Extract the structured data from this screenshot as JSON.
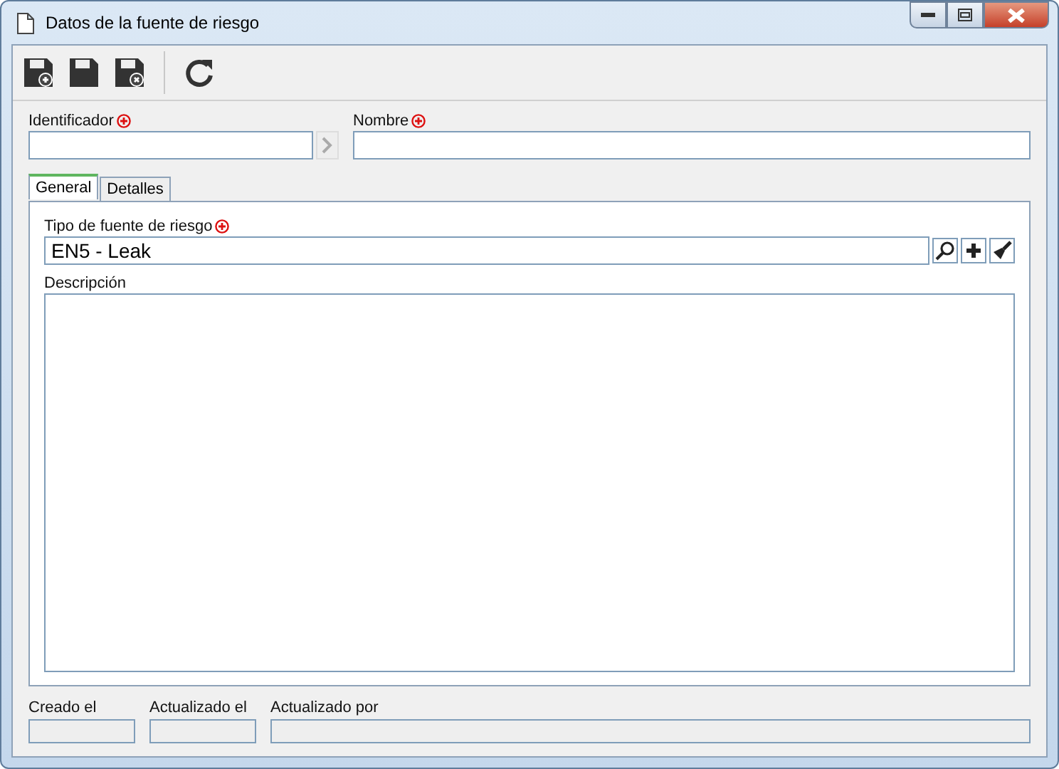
{
  "window": {
    "title": "Datos de la fuente de riesgo"
  },
  "toolbar": [
    {
      "kind": "save-new"
    },
    {
      "kind": "save"
    },
    {
      "kind": "save-close"
    },
    {
      "kind": "refresh"
    }
  ],
  "header_fields": [
    {
      "label": "Identificador",
      "required": true,
      "has_next": true
    },
    {
      "label": "Nombre",
      "required": true,
      "has_next": false
    }
  ],
  "tabs": [
    {
      "label": "General",
      "selected": true
    },
    {
      "label": "Detalles",
      "selected": false
    }
  ],
  "risk_source_type": {
    "label": "Tipo de fuente de riesgo",
    "required": true,
    "value": "EN5 - Leak"
  },
  "description": {
    "label": "Descripción"
  },
  "footer_fields": [
    {
      "label": "Creado el",
      "disabled": true
    },
    {
      "label": "Actualizado el",
      "disabled": true
    },
    {
      "label": "Actualizado por",
      "disabled": true
    }
  ]
}
